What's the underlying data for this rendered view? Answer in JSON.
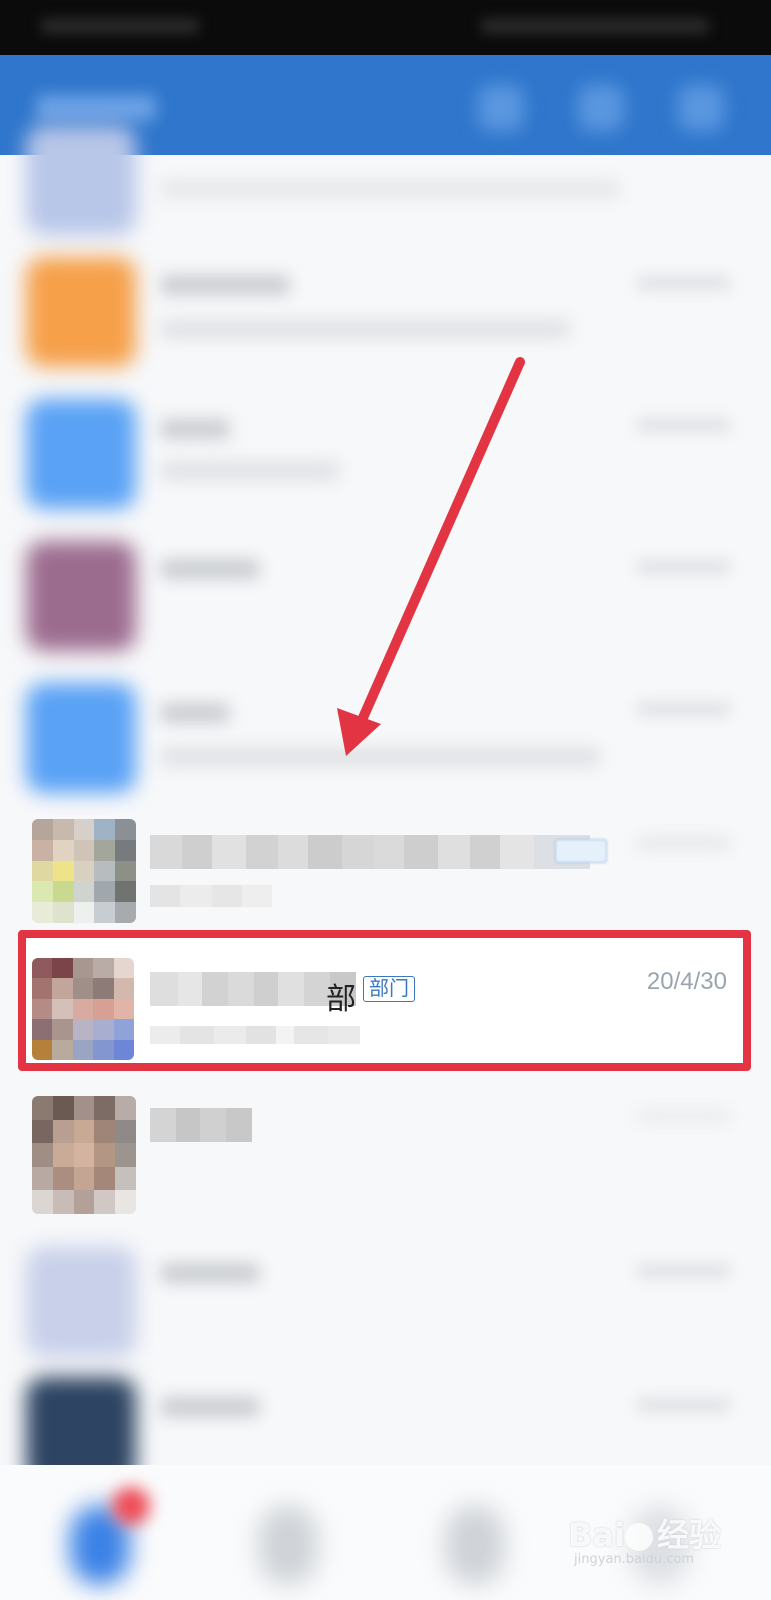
{
  "highlighted_conversation": {
    "name_visible_suffix": "部",
    "tag": "部门",
    "date": "20/4/30"
  },
  "watermark": {
    "brand": "Bai",
    "brand2": "经验",
    "url": "jingyan.baidu.com"
  },
  "colors": {
    "appbar": "#2f76cc",
    "highlight": "#e23442",
    "tag": "#3b78c3",
    "date": "#9aa4b0"
  },
  "icons": [
    "search-icon",
    "add-icon",
    "more-icon",
    "arrow-annotation-icon"
  ]
}
